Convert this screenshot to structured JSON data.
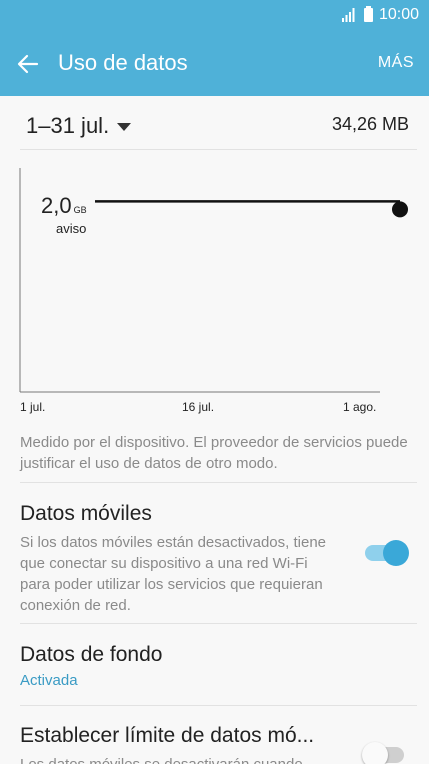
{
  "status": {
    "time": "10:00",
    "icons": [
      "signal-icon",
      "battery-icon"
    ]
  },
  "appbar": {
    "title": "Uso de datos",
    "more_label": "MÁS",
    "back_icon": "arrow-left-icon"
  },
  "range": {
    "label": "1–31 jul.",
    "usage": "34,26 MB"
  },
  "chart_data": {
    "type": "line",
    "x_ticks": [
      "1 jul.",
      "16 jul.",
      "1 ago."
    ],
    "limit": {
      "value": "2,0",
      "unit": "GB",
      "label": "aviso"
    },
    "series": [
      {
        "x": [
          "1 jul.",
          "1 ago."
        ],
        "values": [
          2.0,
          2.0
        ]
      }
    ]
  },
  "note": "Medido por el dispositivo. El proveedor de servicios puede justificar el uso de datos de otro modo.",
  "settings": {
    "mobile_data": {
      "title": "Datos móviles",
      "description": "Si los datos móviles están desactivados, tiene que conectar su dispositivo a una red Wi-Fi para poder utilizar los servicios que requieran conexión de red.",
      "enabled": true
    },
    "background_data": {
      "title": "Datos de fondo",
      "status": "Activada"
    },
    "limit_mobile": {
      "title": "Establecer límite de datos mó...",
      "description": "Los datos móviles se desactivarán cuando",
      "enabled": false
    }
  },
  "colors": {
    "accent": "#4fb1d8",
    "link": "#3a9bc4",
    "toggle_on": "#3aa8d8"
  }
}
